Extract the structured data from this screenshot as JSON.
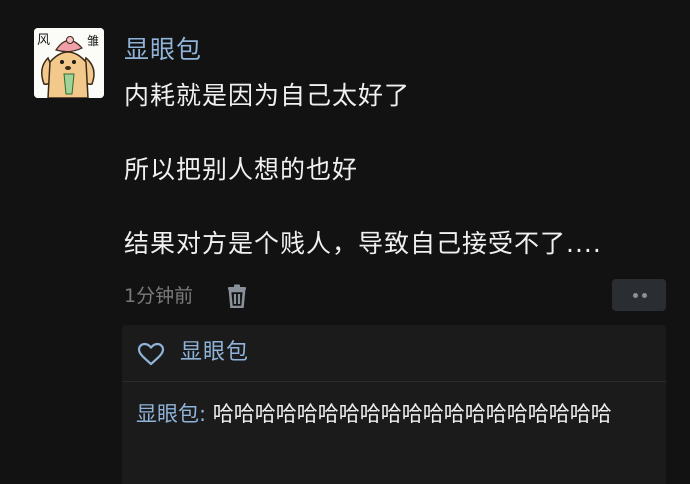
{
  "post": {
    "author": "显眼包",
    "avatar_icon": "cartoon-dog-avatar",
    "avatar_text_left": "风",
    "avatar_text_right": "雏",
    "content_lines": [
      "内耗就是因为自己太好了",
      "所以把别人想的也好",
      "结果对方是个贱人，导致自己接受不了...."
    ],
    "time": "1分钟前",
    "delete_icon": "trash-icon",
    "more_icon": "more-dots-icon"
  },
  "likes": {
    "icon": "heart-icon",
    "names": "显眼包"
  },
  "comment": {
    "author": "显眼包",
    "separator": ": ",
    "text": "哈哈哈哈哈哈哈哈哈哈哈哈哈哈哈哈哈哈哈"
  },
  "colors": {
    "background": "#121212",
    "name_blue": "#8fb3d9",
    "text": "#f0f0f0",
    "muted": "#7a7a7a",
    "comment_bg": "#1b1b1b"
  }
}
